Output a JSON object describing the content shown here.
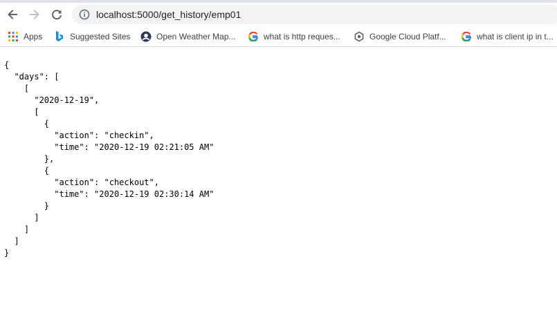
{
  "browser": {
    "url": "localhost:5000/get_history/emp01"
  },
  "bookmarks": [
    {
      "label": "Apps",
      "icon": "apps-grid-icon"
    },
    {
      "label": "Suggested Sites",
      "icon": "bing-icon"
    },
    {
      "label": "Open Weather Map...",
      "icon": "openweather-icon"
    },
    {
      "label": "what is http reques...",
      "icon": "google-icon"
    },
    {
      "label": "Google Cloud Platf...",
      "icon": "google-cloud-icon"
    },
    {
      "label": "what is client ip in t...",
      "icon": "google-icon"
    }
  ],
  "json_lines": [
    "{",
    "  \"days\": [",
    "    [",
    "      \"2020-12-19\",",
    "      [",
    "        {",
    "          \"action\": \"checkin\",",
    "          \"time\": \"2020-12-19 02:21:05 AM\"",
    "        },",
    "        {",
    "          \"action\": \"checkout\",",
    "          \"time\": \"2020-12-19 02:30:14 AM\"",
    "        }",
    "      ]",
    "    ]",
    "  ]",
    "}"
  ]
}
